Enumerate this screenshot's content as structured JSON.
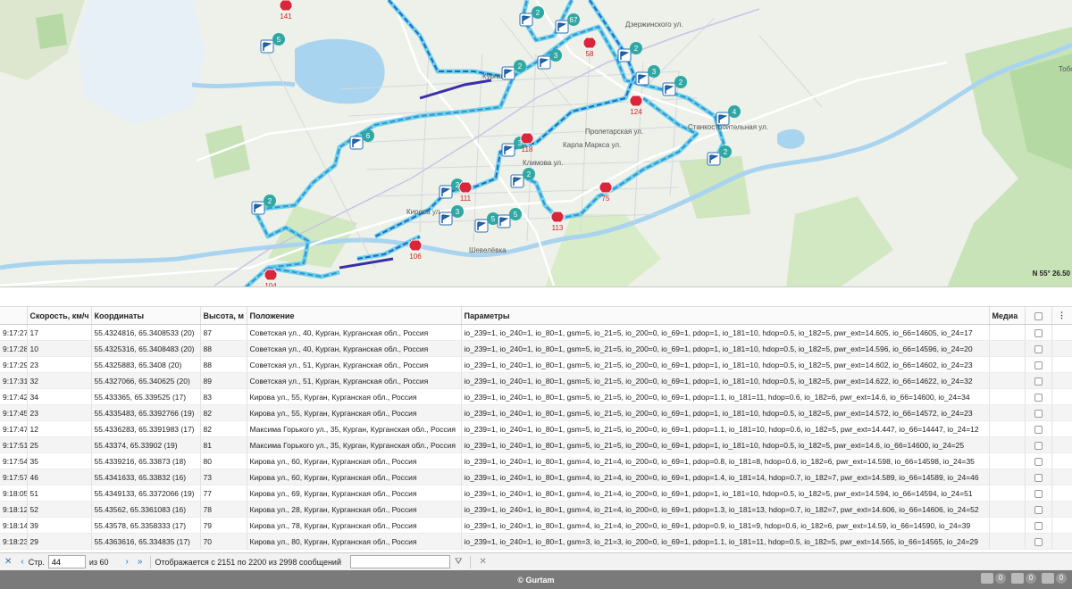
{
  "map": {
    "coordinate_readout": "N 55° 26.50",
    "place_labels": [
      "Курган",
      "Шевелёвка",
      "Дзержинского ул.",
      "Тобол",
      "Пролетарская ул.",
      "Климова ул.",
      "Кирова ул.",
      "Карла Маркса ул.",
      "Станкостроительная ул."
    ],
    "cluster_counts": [
      "5",
      "6",
      "2",
      "2",
      "3",
      "2",
      "3",
      "2",
      "5",
      "2",
      "67",
      "2",
      "3",
      "5",
      "2",
      "4",
      "2",
      "3"
    ],
    "stop_labels": [
      "141",
      "58",
      "124",
      "118",
      "111",
      "75",
      "113",
      "106",
      "104"
    ]
  },
  "table": {
    "columns": [
      "Скорость, км/ч",
      "Координаты",
      "Высота, м",
      "Положение",
      "Параметры",
      "Медиа"
    ],
    "rows": [
      {
        "time": "9:17:27",
        "speed": "17",
        "coords": "55.4324816, 65.3408533 (20)",
        "alt": "87",
        "pos": "Советская ул., 40, Курган, Курганская обл., Россия",
        "params": "io_239=1, io_240=1, io_80=1, gsm=5, io_21=5, io_200=0, io_69=1, pdop=1, io_181=10, hdop=0.5, io_182=5, pwr_ext=14.605, io_66=14605, io_24=17"
      },
      {
        "time": "9:17:28",
        "speed": "10",
        "coords": "55.4325316, 65.3408483 (20)",
        "alt": "88",
        "pos": "Советская ул., 40, Курган, Курганская обл., Россия",
        "params": "io_239=1, io_240=1, io_80=1, gsm=5, io_21=5, io_200=0, io_69=1, pdop=1, io_181=10, hdop=0.5, io_182=5, pwr_ext=14.596, io_66=14596, io_24=20"
      },
      {
        "time": "9:17:29",
        "speed": "23",
        "coords": "55.4325883, 65.3408 (20)",
        "alt": "88",
        "pos": "Советская ул., 51, Курган, Курганская обл., Россия",
        "params": "io_239=1, io_240=1, io_80=1, gsm=5, io_21=5, io_200=0, io_69=1, pdop=1, io_181=10, hdop=0.5, io_182=5, pwr_ext=14.602, io_66=14602, io_24=23"
      },
      {
        "time": "9:17:31",
        "speed": "32",
        "coords": "55.4327066, 65.340625 (20)",
        "alt": "89",
        "pos": "Советская ул., 51, Курган, Курганская обл., Россия",
        "params": "io_239=1, io_240=1, io_80=1, gsm=5, io_21=5, io_200=0, io_69=1, pdop=1, io_181=10, hdop=0.5, io_182=5, pwr_ext=14.622, io_66=14622, io_24=32"
      },
      {
        "time": "9:17:42",
        "speed": "34",
        "coords": "55.433365, 65.339525 (17)",
        "alt": "83",
        "pos": "Кирова ул., 55, Курган, Курганская обл., Россия",
        "params": "io_239=1, io_240=1, io_80=1, gsm=5, io_21=5, io_200=0, io_69=1, pdop=1.1, io_181=11, hdop=0.6, io_182=6, pwr_ext=14.6, io_66=14600, io_24=34"
      },
      {
        "time": "9:17:45",
        "speed": "23",
        "coords": "55.4335483, 65.3392766 (19)",
        "alt": "82",
        "pos": "Кирова ул., 55, Курган, Курганская обл., Россия",
        "params": "io_239=1, io_240=1, io_80=1, gsm=5, io_21=5, io_200=0, io_69=1, pdop=1, io_181=10, hdop=0.5, io_182=5, pwr_ext=14.572, io_66=14572, io_24=23"
      },
      {
        "time": "9:17:47",
        "speed": "12",
        "coords": "55.4336283, 65.3391983 (17)",
        "alt": "82",
        "pos": "Максима Горького ул., 35, Курган, Курганская обл., Россия",
        "params": "io_239=1, io_240=1, io_80=1, gsm=5, io_21=5, io_200=0, io_69=1, pdop=1.1, io_181=10, hdop=0.6, io_182=5, pwr_ext=14.447, io_66=14447, io_24=12"
      },
      {
        "time": "9:17:51",
        "speed": "25",
        "coords": "55.43374, 65.33902 (19)",
        "alt": "81",
        "pos": "Максима Горького ул., 35, Курган, Курганская обл., Россия",
        "params": "io_239=1, io_240=1, io_80=1, gsm=5, io_21=5, io_200=0, io_69=1, pdop=1, io_181=10, hdop=0.5, io_182=5, pwr_ext=14.6, io_66=14600, io_24=25"
      },
      {
        "time": "9:17:54",
        "speed": "35",
        "coords": "55.4339216, 65.33873 (18)",
        "alt": "80",
        "pos": "Кирова ул., 60, Курган, Курганская обл., Россия",
        "params": "io_239=1, io_240=1, io_80=1, gsm=4, io_21=4, io_200=0, io_69=1, pdop=0.8, io_181=8, hdop=0.6, io_182=6, pwr_ext=14.598, io_66=14598, io_24=35"
      },
      {
        "time": "9:17:57",
        "speed": "46",
        "coords": "55.4341633, 65.33832 (16)",
        "alt": "73",
        "pos": "Кирова ул., 60, Курган, Курганская обл., Россия",
        "params": "io_239=1, io_240=1, io_80=1, gsm=4, io_21=4, io_200=0, io_69=1, pdop=1.4, io_181=14, hdop=0.7, io_182=7, pwr_ext=14.589, io_66=14589, io_24=46"
      },
      {
        "time": "9:18:05",
        "speed": "51",
        "coords": "55.4349133, 65.3372066 (19)",
        "alt": "77",
        "pos": "Кирова ул., 69, Курган, Курганская обл., Россия",
        "params": "io_239=1, io_240=1, io_80=1, gsm=4, io_21=4, io_200=0, io_69=1, pdop=1, io_181=10, hdop=0.5, io_182=5, pwr_ext=14.594, io_66=14594, io_24=51"
      },
      {
        "time": "9:18:12",
        "speed": "52",
        "coords": "55.43562, 65.3361083 (16)",
        "alt": "78",
        "pos": "Кирова ул., 28, Курган, Курганская обл., Россия",
        "params": "io_239=1, io_240=1, io_80=1, gsm=4, io_21=4, io_200=0, io_69=1, pdop=1.3, io_181=13, hdop=0.7, io_182=7, pwr_ext=14.606, io_66=14606, io_24=52"
      },
      {
        "time": "9:18:14",
        "speed": "39",
        "coords": "55.43578, 65.3358333 (17)",
        "alt": "79",
        "pos": "Кирова ул., 78, Курган, Курганская обл., Россия",
        "params": "io_239=1, io_240=1, io_80=1, gsm=4, io_21=4, io_200=0, io_69=1, pdop=0.9, io_181=9, hdop=0.6, io_182=6, pwr_ext=14.59, io_66=14590, io_24=39"
      },
      {
        "time": "9:18:23",
        "speed": "29",
        "coords": "55.4363616, 65.334835 (17)",
        "alt": "70",
        "pos": "Кирова ул., 80, Курган, Курганская обл., Россия",
        "params": "io_239=1, io_240=1, io_80=1, gsm=3, io_21=3, io_200=0, io_69=1, pdop=1.1, io_181=11, hdop=0.5, io_182=5, pwr_ext=14.565, io_66=14565, io_24=29"
      }
    ]
  },
  "pager": {
    "page_label": "Стр.",
    "page_value": "44",
    "page_total": "из 60",
    "info": "Отображается с 2151 по 2200 из 2998 сообщений"
  },
  "footer": {
    "brand": "© Gurtam",
    "counts": [
      "0",
      "0",
      "0"
    ]
  },
  "colors": {
    "track_light": "#5ad0e8",
    "track_dark": "#2a5fd0",
    "track_slow": "#3b2fa8",
    "stop": "#d9263a",
    "cluster": "#2fa8a4",
    "water": "#a8d4f0",
    "forest": "#c8e3b8"
  }
}
